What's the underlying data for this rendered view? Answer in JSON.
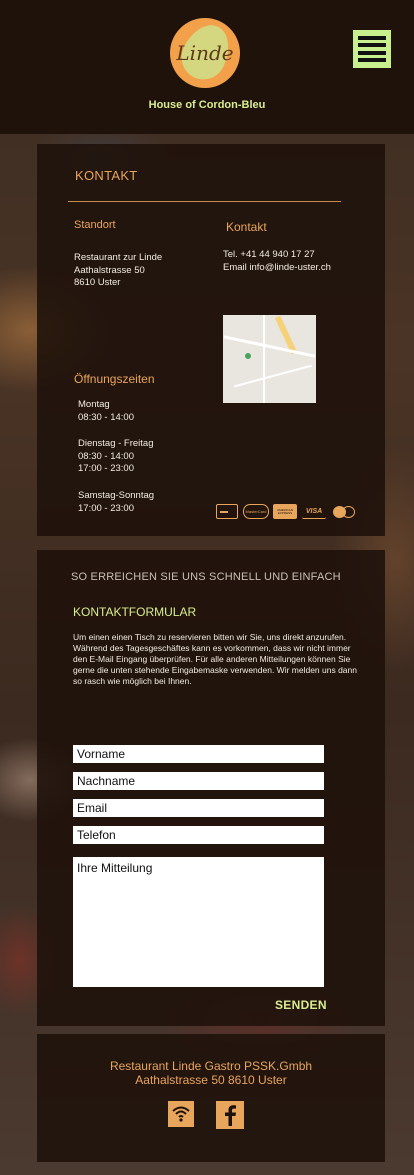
{
  "header": {
    "logo_text": "Linde",
    "tagline": "House of Cordon-Bleu"
  },
  "kontakt": {
    "title": "KONTAKT",
    "standort": {
      "heading": "Standort",
      "name": "Restaurant zur Linde",
      "street": "Aathalstrasse 50",
      "city": "8610 Uster"
    },
    "contact": {
      "heading": "Kontakt",
      "tel": "Tel. +41 44 940 17 27",
      "email": "Email  info@linde-uster.ch"
    },
    "hours": {
      "heading": "Öffnungszeiten",
      "blocks": [
        {
          "days": "Montag",
          "line1": "08:30 - 14:00",
          "line2": ""
        },
        {
          "days": "Dienstag - Freitag",
          "line1": "08:30 - 14:00",
          "line2": "17:00 - 23:00"
        },
        {
          "days": "Samstag-Sonntag",
          "line1": "17:00 - 23:00",
          "line2": ""
        }
      ]
    },
    "payment_icons": [
      "card-icon",
      "mastercard-icon",
      "amex-icon",
      "visa-icon",
      "maestro-icon"
    ],
    "payment_labels": {
      "mastercard": "MasterCard",
      "amex": "AMERICAN EXPRESS",
      "visa": "VISA"
    }
  },
  "form": {
    "heading": "SO ERREICHEN SIE UNS SCHNELL UND EINFACH",
    "title": "KONTAKTFORMULAR",
    "intro": "Um einen einen Tisch zu reservieren bitten wir Sie, uns direkt anzurufen. Während des Tagesgeschäftes kann es vorkommen, dass wir nicht immer den E-Mail Eingang überprüfen. Für alle anderen Mitteilungen können Sie gerne die unten stehende Eingabemaske verwenden. Wir melden uns dann so rasch wie möglich bei Ihnen.",
    "fields": {
      "vorname": "Vorname",
      "nachname": "Nachname",
      "email": "Email",
      "telefon": "Telefon",
      "message": "Ihre Mitteilung"
    },
    "submit_label": "SENDEN"
  },
  "footer": {
    "line1": "Restaurant Linde Gastro PSSK.Gmbh",
    "line2": "Aathalstrasse 50 8610 Uster",
    "icons": [
      "wifi-icon",
      "facebook-icon"
    ]
  },
  "colors": {
    "accent_orange": "#e8a55c",
    "accent_green": "#d9ee8e",
    "header_bg": "#1f120b",
    "card_bg": "#1e110a"
  }
}
